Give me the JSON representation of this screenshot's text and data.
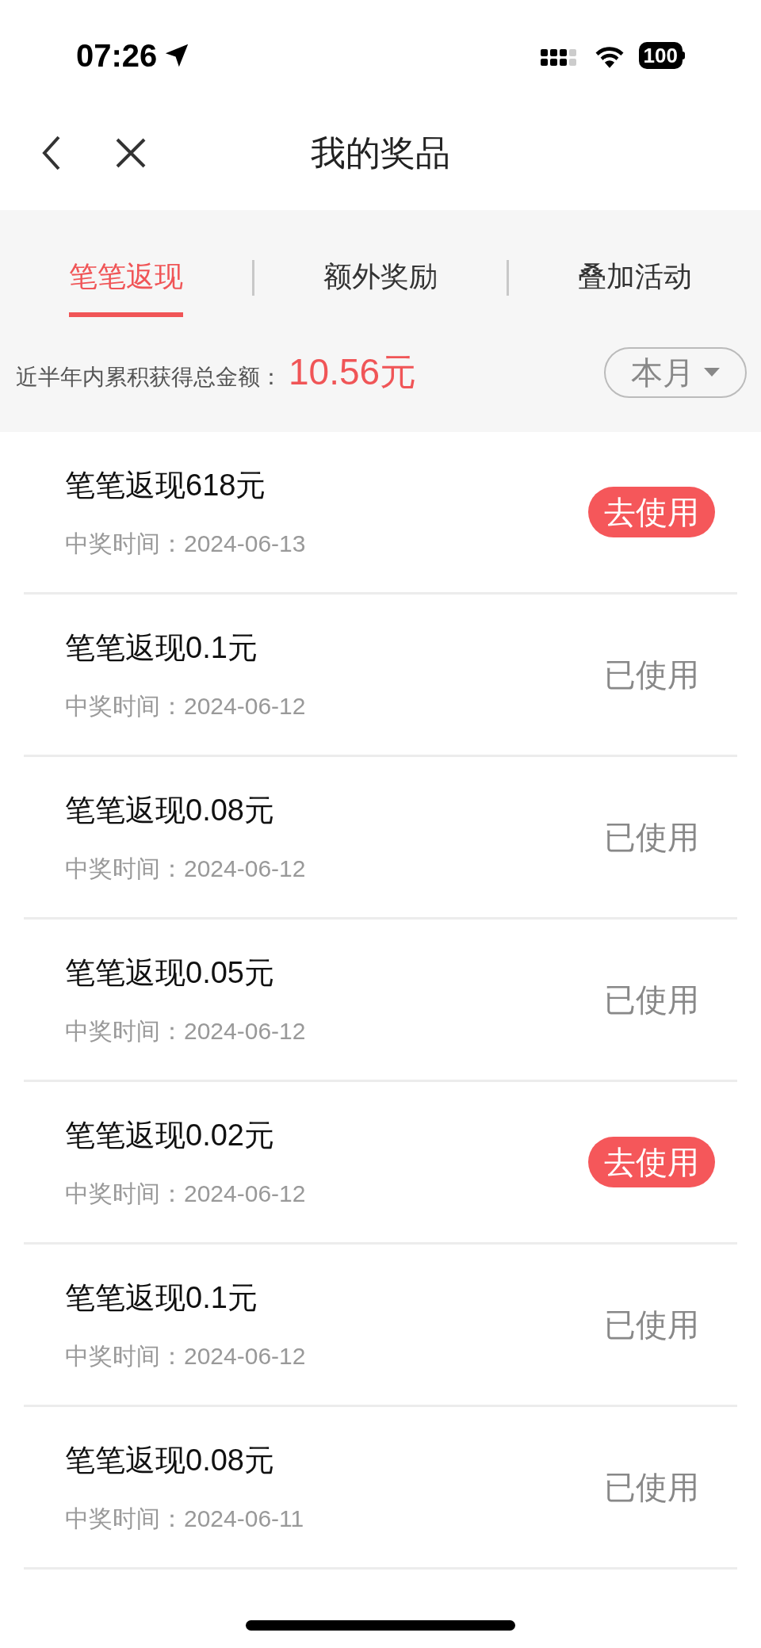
{
  "status_bar": {
    "time": "07:26",
    "battery": "100"
  },
  "nav": {
    "title": "我的奖品"
  },
  "tabs": [
    {
      "label": "笔笔返现",
      "selected": true
    },
    {
      "label": "额外奖励",
      "selected": false
    },
    {
      "label": "叠加活动",
      "selected": false
    }
  ],
  "summary": {
    "label": "近半年内累积获得总金额：",
    "amount": "10.56元",
    "filter": "本月"
  },
  "prizes": [
    {
      "title": "笔笔返现618元",
      "date": "中奖时间：2024-06-13",
      "action": "去使用",
      "used": false
    },
    {
      "title": "笔笔返现0.1元",
      "date": "中奖时间：2024-06-12",
      "action": "已使用",
      "used": true
    },
    {
      "title": "笔笔返现0.08元",
      "date": "中奖时间：2024-06-12",
      "action": "已使用",
      "used": true
    },
    {
      "title": "笔笔返现0.05元",
      "date": "中奖时间：2024-06-12",
      "action": "已使用",
      "used": true
    },
    {
      "title": "笔笔返现0.02元",
      "date": "中奖时间：2024-06-12",
      "action": "去使用",
      "used": false
    },
    {
      "title": "笔笔返现0.1元",
      "date": "中奖时间：2024-06-12",
      "action": "已使用",
      "used": true
    },
    {
      "title": "笔笔返现0.08元",
      "date": "中奖时间：2024-06-11",
      "action": "已使用",
      "used": true
    }
  ]
}
